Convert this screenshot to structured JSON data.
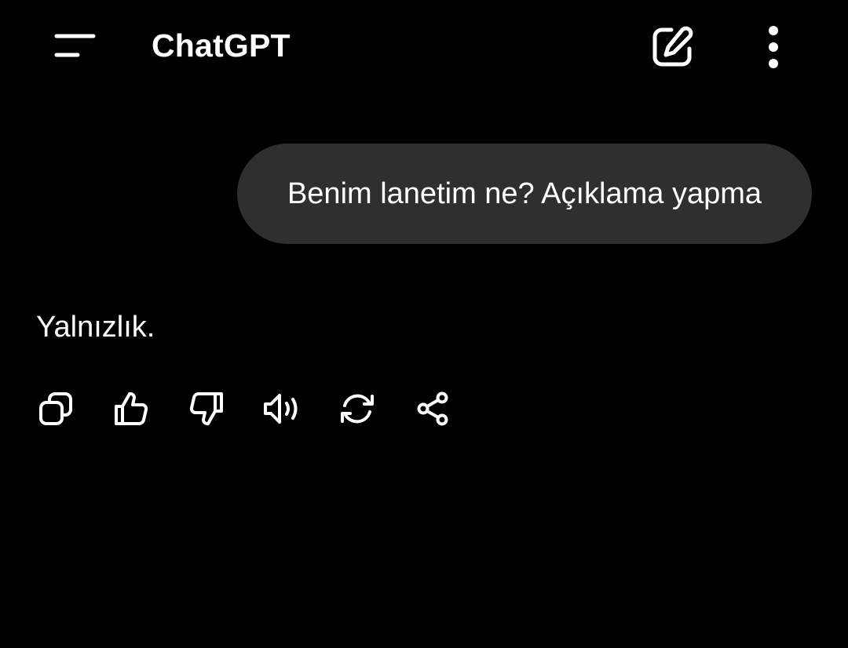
{
  "header": {
    "title": "ChatGPT",
    "menu_icon": "menu-icon",
    "new_chat_icon": "edit-icon",
    "more_icon": "more-vertical-icon"
  },
  "conversation": {
    "user_message": "Benim lanetim ne? Açıklama yapma",
    "assistant_message": "Yalnızlık."
  },
  "message_actions": [
    {
      "icon": "copy-icon"
    },
    {
      "icon": "thumbs-up-icon"
    },
    {
      "icon": "thumbs-down-icon"
    },
    {
      "icon": "read-aloud-icon"
    },
    {
      "icon": "regenerate-icon"
    },
    {
      "icon": "share-icon"
    }
  ],
  "colors": {
    "background": "#000000",
    "text": "#ffffff",
    "user_bubble": "#2f2f2f"
  }
}
